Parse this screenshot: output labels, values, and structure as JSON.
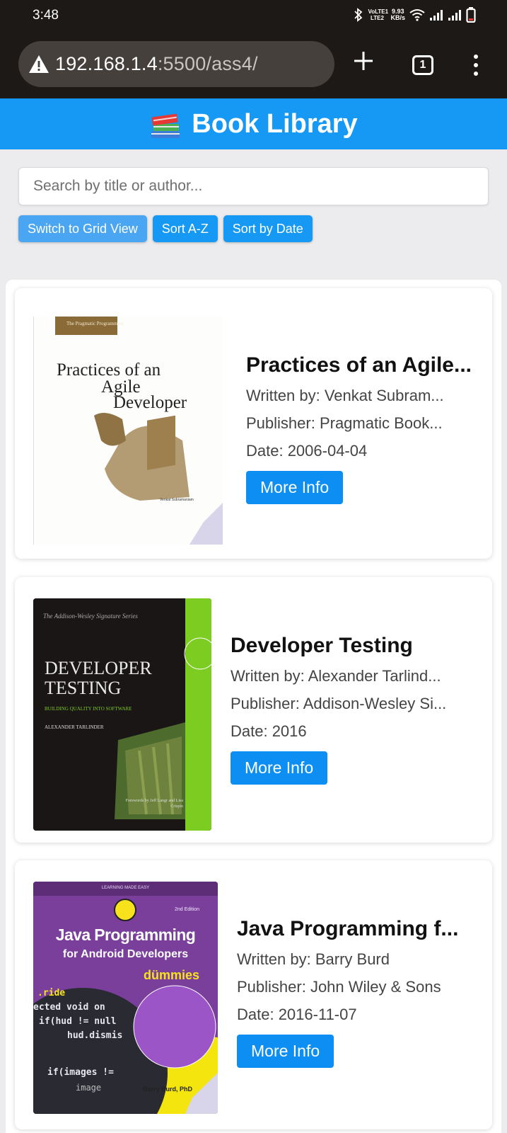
{
  "status_bar": {
    "time": "3:48",
    "network_label": "VoLTE1 LTE2",
    "speed_value": "9.93",
    "speed_unit": "KB/s",
    "icons": [
      "bluetooth-icon",
      "wifi-icon",
      "signal-icon",
      "signal-icon",
      "battery-icon"
    ]
  },
  "browser": {
    "url_host": "192.168.1.4",
    "url_path": ":5500/ass4/",
    "tab_count": "1",
    "icons": [
      "warning-icon",
      "plus-icon",
      "tabs-icon",
      "menu-icon"
    ]
  },
  "header": {
    "title": "Book Library",
    "icon": "books-icon",
    "bg_color": "#1699f5"
  },
  "search": {
    "placeholder": "Search by title or author...",
    "value": ""
  },
  "controls": {
    "grid_view": "Switch to Grid View",
    "sort_az": "Sort A-Z",
    "sort_date": "Sort by Date"
  },
  "books": [
    {
      "title": "Practices of an Agile...",
      "author": "Written by: Venkat Subram...",
      "publisher": "Publisher: Pragmatic Book...",
      "date": "Date: 2006-04-04",
      "button": "More Info",
      "cover": {
        "series": "The Pragmatic Programmers",
        "line1": "Practices of an",
        "line2": "Agile",
        "line3": "Developer",
        "author": "Venkat Subramaniam"
      }
    },
    {
      "title": "Developer Testing",
      "author": "Written by: Alexander Tarlind...",
      "publisher": "Publisher: Addison-Wesley Si...",
      "date": "Date: 2016",
      "button": "More Info",
      "cover": {
        "series": "The Addison-Wesley Signature Series",
        "line1": "DEVELOPER",
        "line2": "TESTING",
        "subtitle": "BUILDING QUALITY INTO SOFTWARE",
        "author": "ALEXANDER TARLINDER",
        "foreword": "Forewords by Jeff Langr and Lisa Crispin"
      }
    },
    {
      "title": "Java Programming f...",
      "author": "Written by: Barry Burd",
      "publisher": "Publisher: John Wiley & Sons",
      "date": "Date: 2016-11-07",
      "button": "More Info",
      "cover": {
        "banner": "LEARNING MADE EASY",
        "edition": "2nd Edition",
        "line1": "Java Programming",
        "line2": "for Android Developers",
        "brand": "dümmies",
        "code1": ".ride",
        "code2": "ected void on",
        "code3": "if(hud != null",
        "code4": "hud.dismis",
        "code5": "if(images !=",
        "code6": "image",
        "author": "Barry Burd, PhD"
      }
    }
  ]
}
